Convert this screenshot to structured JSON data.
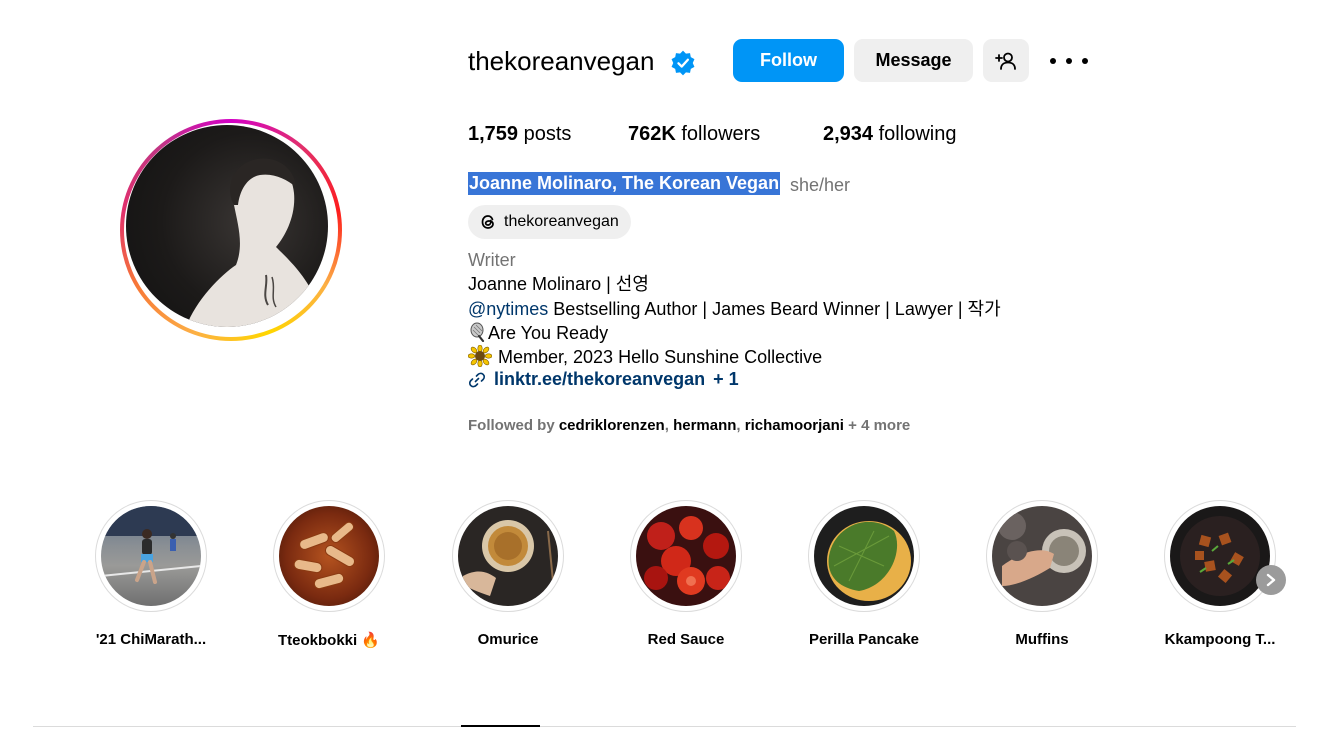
{
  "profile": {
    "username": "thekoreanvegan",
    "full_name": "Joanne Molinaro, The Korean Vegan",
    "pronouns": "she/her",
    "threads_handle": "thekoreanvegan"
  },
  "actions": {
    "follow_label": "Follow",
    "message_label": "Message"
  },
  "stats": {
    "posts_count": "1,759",
    "posts_label": "posts",
    "followers_count": "762K",
    "followers_label": "followers",
    "following_count": "2,934",
    "following_label": "following"
  },
  "bio": {
    "category": "Writer",
    "line1": "Joanne Molinaro | 선영",
    "mention": "@nytimes",
    "line2_rest": " Bestselling Author | James Beard Winner | Lawyer | 작가",
    "line3": "Are You Ready",
    "line4": "Member, 2023 Hello Sunshine Collective",
    "link": "linktr.ee/thekoreanvegan",
    "link_extra": "+ 1"
  },
  "followed_by": {
    "prefix": "Followed by ",
    "user1": "cedriklorenzen",
    "user2": "hermann",
    "user3": "richamoorjani",
    "more": " + 4 more"
  },
  "highlights": [
    {
      "label": "'21 ChiMarath..."
    },
    {
      "label": "Tteokbokki 🔥"
    },
    {
      "label": "Omurice"
    },
    {
      "label": "Red Sauce"
    },
    {
      "label": "Perilla Pancake"
    },
    {
      "label": "Muffins"
    },
    {
      "label": "Kkampoong T..."
    }
  ],
  "colors": {
    "primary_button": "#0095f6",
    "secondary_button": "#efefef",
    "link": "#00376b",
    "muted_text": "#737373",
    "selection_highlight": "#3875d7",
    "verified_badge": "#0095f6"
  }
}
